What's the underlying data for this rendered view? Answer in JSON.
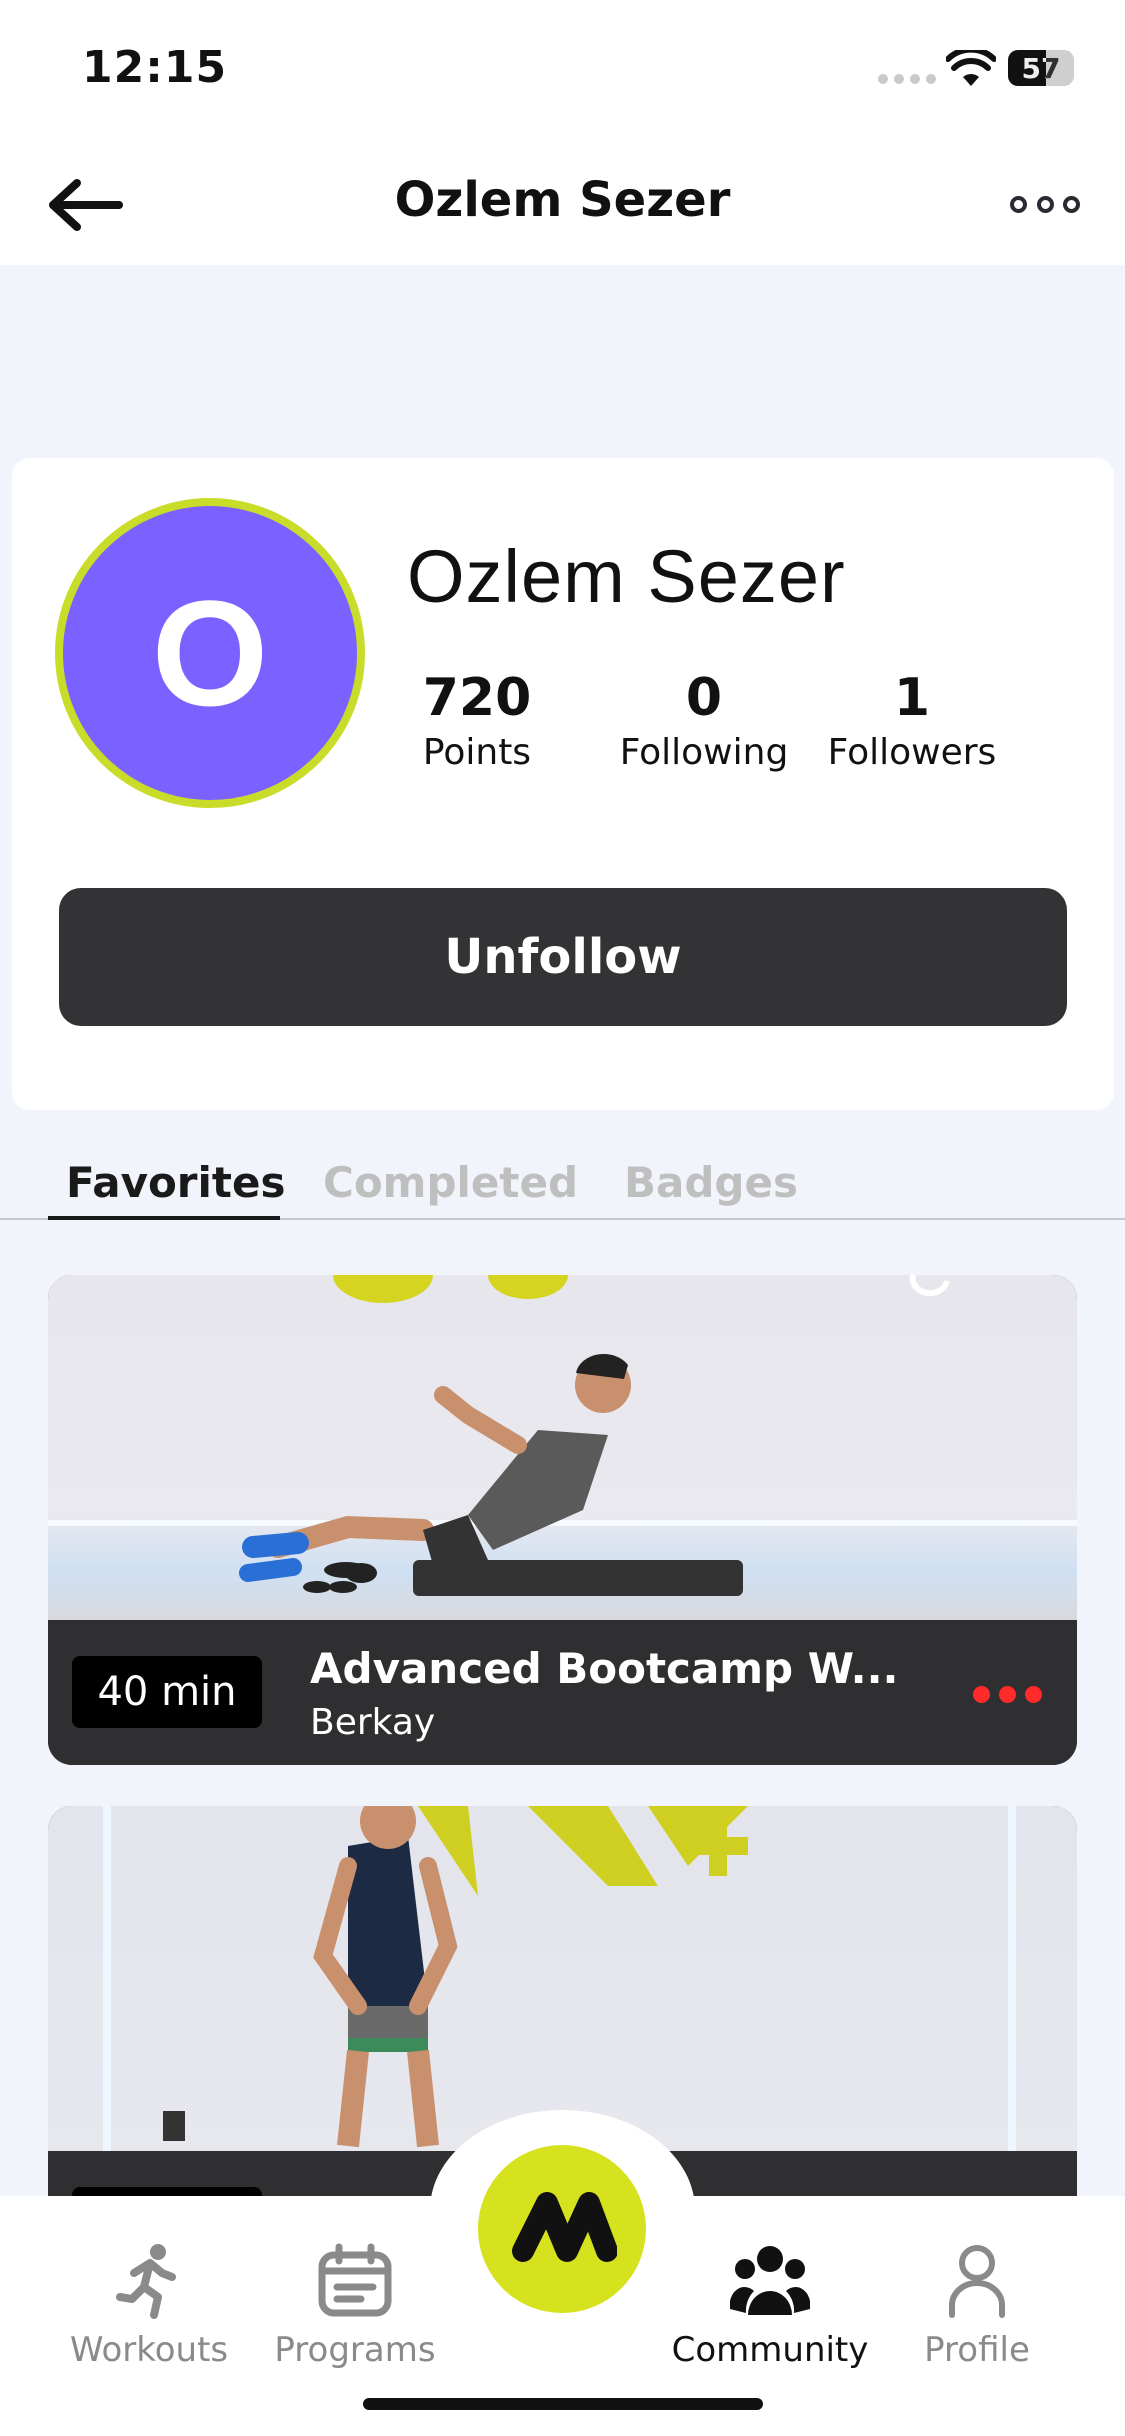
{
  "status_bar": {
    "time": "12:15",
    "battery": "57"
  },
  "nav": {
    "title": "Ozlem Sezer"
  },
  "profile": {
    "avatar_letter": "O",
    "name": "Ozlem Sezer",
    "stats": [
      {
        "value": "720",
        "label": "Points"
      },
      {
        "value": "0",
        "label": "Following"
      },
      {
        "value": "1",
        "label": "Followers"
      }
    ],
    "action_label": "Unfollow"
  },
  "tabs": [
    {
      "label": "Favorites",
      "active": true
    },
    {
      "label": "Completed",
      "active": false
    },
    {
      "label": "Badges",
      "active": false
    }
  ],
  "workouts": [
    {
      "duration": "40 min",
      "title": "Advanced Bootcamp W...",
      "trainer": "Berkay"
    },
    {
      "duration": "",
      "title": "",
      "trainer": ""
    }
  ],
  "tab_bar": {
    "items": [
      {
        "label": "Workouts",
        "icon": "running-icon"
      },
      {
        "label": "Programs",
        "icon": "calendar-icon"
      },
      {
        "label": "Community",
        "icon": "community-icon",
        "active": true
      },
      {
        "label": "Profile",
        "icon": "profile-icon"
      }
    ]
  },
  "colors": {
    "avatar_bg": "#7b61ff",
    "avatar_ring": "#c9dc2a",
    "accent": "#d6e21e",
    "button_dark": "#333336",
    "more_dots": "#ff2a2a"
  }
}
